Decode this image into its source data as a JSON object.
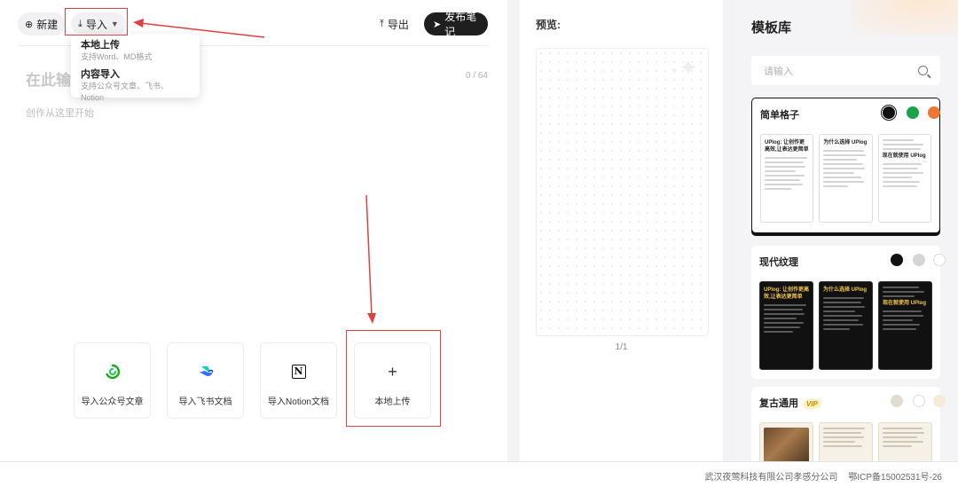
{
  "editor": {
    "toolbar": {
      "new_label": "新建",
      "import_label": "导入",
      "export_label": "导出",
      "publish_label": "发布笔记"
    },
    "import_menu": [
      {
        "title": "本地上传",
        "desc": "支持Word、MD格式"
      },
      {
        "title": "内容导入",
        "desc": "支持公众号文章、飞书、Notion"
      }
    ],
    "title_placeholder": "在此输入",
    "char_counter": "0 / 64",
    "body_placeholder": "创作从这里开始",
    "import_cards": [
      {
        "icon": "wechat-icon",
        "label": "导入公众号文章"
      },
      {
        "icon": "feishu-icon",
        "label": "导入飞书文档"
      },
      {
        "icon": "notion-icon",
        "label": "导入Notion文档"
      },
      {
        "icon": "plus-icon",
        "label": "本地上传"
      }
    ]
  },
  "preview": {
    "label": "预览:",
    "page_indicator": "1/1"
  },
  "templates": {
    "title": "模板库",
    "search_placeholder": "请输入",
    "items": [
      {
        "name": "简单格子",
        "swatches": [
          "#111111",
          "#1aa34a",
          "#ee7733"
        ],
        "selected": 0,
        "thumb_title": "UPlog: 让创作更高效,让表达更简单",
        "thumb_title_2": "为什么选择 UPlog",
        "thumb_title_3": "现在就使用 UPlog"
      },
      {
        "name": "现代纹理",
        "swatches": [
          "#111111",
          "#d5d5d5",
          "#ffffff"
        ],
        "thumb_title": "UPlog: 让创作更高效,让表达更简单",
        "thumb_title_2": "为什么选择 UPlog",
        "thumb_title_3": "现在就使用 UPlog"
      },
      {
        "name": "复古通用",
        "vip": "VIP",
        "swatches": [
          "#e0dccf",
          "#ffffff",
          "#f6ecd6"
        ]
      }
    ]
  },
  "footer": {
    "company": "武汉夜莺科技有限公司孝感分公司",
    "icp": "鄂ICP备15002531号-26"
  },
  "colors": {
    "accent_dark": "#1f1f1f",
    "annotation_red": "#e04040",
    "wechat_green": "#1aad19",
    "feishu_blue": "#3370ff"
  }
}
